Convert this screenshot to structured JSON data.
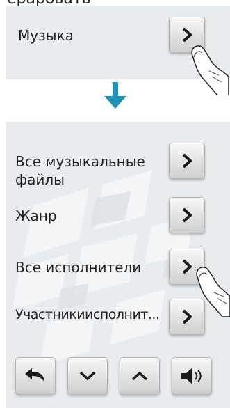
{
  "header_cropped_text": "ераровать",
  "top_panel": {
    "item_label": "Музыка"
  },
  "menu_items": [
    {
      "label_line1": "Все музыкальные",
      "label_line2": "файлы"
    },
    {
      "label": "Жанр"
    },
    {
      "label": "Все исполнители"
    },
    {
      "label": "Участникиисполнит..."
    }
  ],
  "colors": {
    "arrow": "#1f93b5",
    "panel_bg": "#e9ecef"
  },
  "icons": {
    "row_button": "chevron-right-icon",
    "back": "back-arrow-icon",
    "down": "chevron-down-icon",
    "up": "chevron-up-icon",
    "volume": "speaker-icon"
  }
}
